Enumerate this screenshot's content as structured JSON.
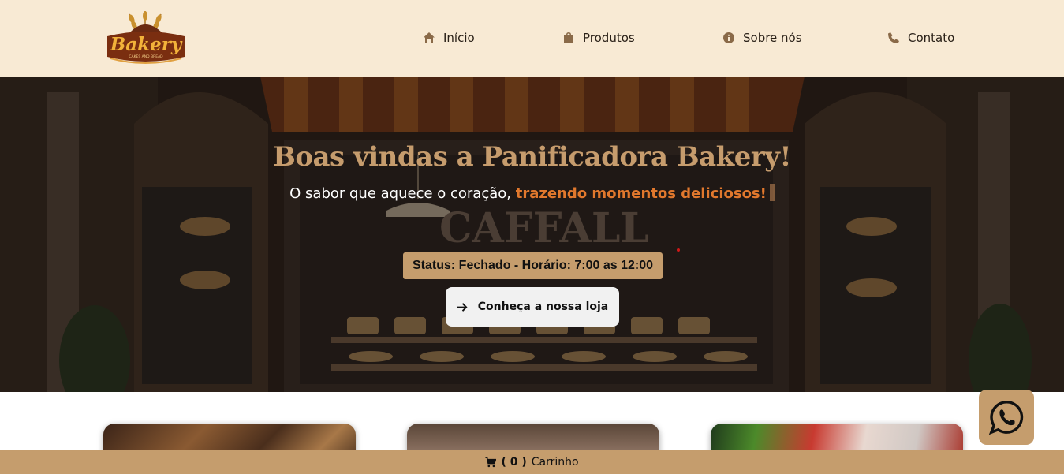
{
  "header": {
    "logo": {
      "text": "Bakery",
      "tagline": "CAKES AND BREAD"
    },
    "nav": [
      {
        "label": "Início",
        "icon": "home-icon"
      },
      {
        "label": "Produtos",
        "icon": "shopping-bag-icon"
      },
      {
        "label": "Sobre nós",
        "icon": "info-icon"
      },
      {
        "label": "Contato",
        "icon": "phone-icon"
      }
    ]
  },
  "hero": {
    "title": "Boas vindas a Panificadora Bakery!",
    "subtitle_plain": "O sabor que aquece o coração, ",
    "subtitle_accent": "trazendo momentos deliciosos!",
    "storefront_sign": "CAFFALL",
    "status": "Status: Fechado - Horário: 7:00 as 12:00",
    "cta_label": "Conheça a nossa loja",
    "cta_icon": "arrow-right-icon"
  },
  "cart": {
    "count": "( 0 )",
    "label": "Carrinho",
    "icon": "cart-icon"
  },
  "whatsapp": {
    "icon": "whatsapp-icon"
  },
  "colors": {
    "header_bg": "#f8ead4",
    "accent_tan": "#c59d6d",
    "title_gold": "#c69c6d",
    "subtitle_orange": "#e1782d",
    "nav_icon": "#8a6a48"
  }
}
